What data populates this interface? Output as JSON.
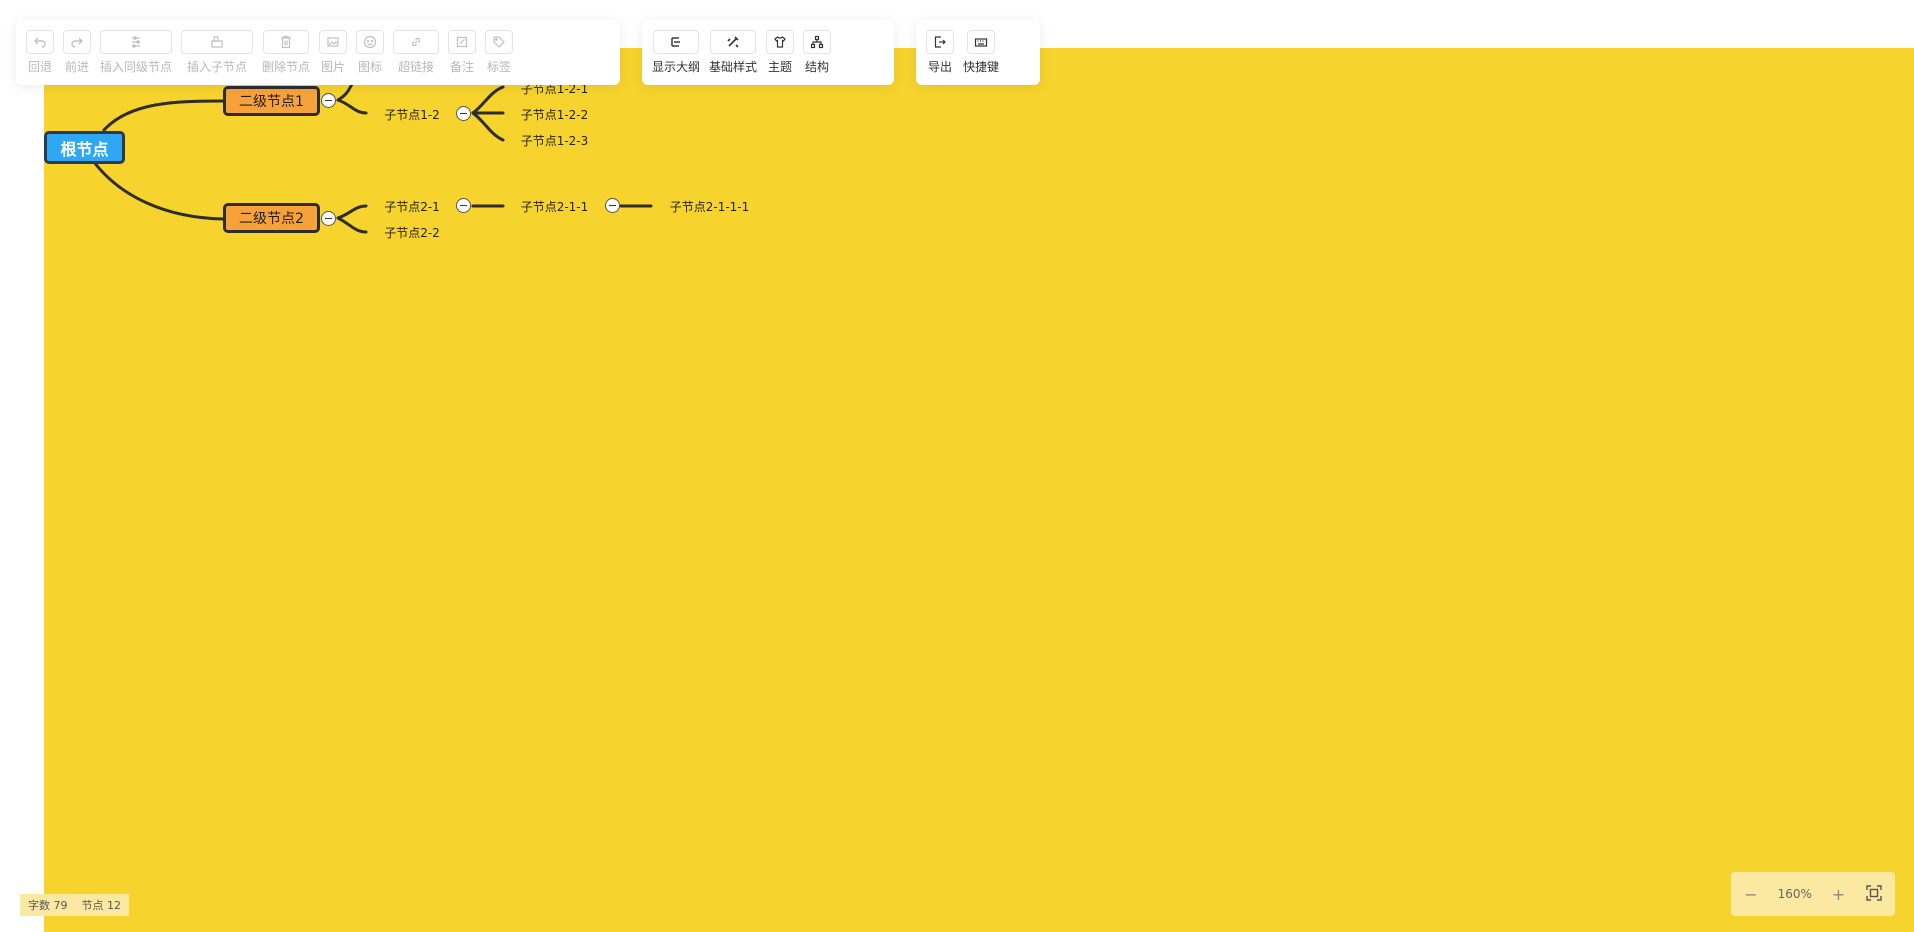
{
  "toolbar": {
    "edit_group": [
      {
        "label": "回退",
        "icon": "undo-icon"
      },
      {
        "label": "前进",
        "icon": "redo-icon"
      },
      {
        "label": "插入同级节点",
        "icon": "insert-sibling-icon"
      },
      {
        "label": "插入子节点",
        "icon": "insert-child-icon"
      },
      {
        "label": "删除节点",
        "icon": "delete-icon"
      },
      {
        "label": "图片",
        "icon": "image-icon"
      },
      {
        "label": "图标",
        "icon": "emoji-icon"
      },
      {
        "label": "超链接",
        "icon": "link-icon"
      },
      {
        "label": "备注",
        "icon": "note-icon"
      },
      {
        "label": "标签",
        "icon": "tag-icon"
      }
    ],
    "view_group": [
      {
        "label": "显示大纲",
        "icon": "outline-icon"
      },
      {
        "label": "基础样式",
        "icon": "style-icon"
      },
      {
        "label": "主题",
        "icon": "theme-icon"
      },
      {
        "label": "结构",
        "icon": "structure-icon"
      }
    ],
    "io_group": [
      {
        "label": "导出",
        "icon": "export-icon"
      },
      {
        "label": "快捷键",
        "icon": "keyboard-icon"
      }
    ]
  },
  "mindmap": {
    "root": "根节点",
    "level2": [
      "二级节点1",
      "二级节点2"
    ],
    "nodes": {
      "n1_2": "子节点1-2",
      "n1_2_1": "子节点1-2-1",
      "n1_2_2": "子节点1-2-2",
      "n1_2_3": "子节点1-2-3",
      "n2_1": "子节点2-1",
      "n2_2": "子节点2-2",
      "n2_1_1": "子节点2-1-1",
      "n2_1_1_1": "子节点2-1-1-1"
    }
  },
  "status": {
    "word_count_label": "字数",
    "word_count": "79",
    "node_count_label": "节点",
    "node_count": "12"
  },
  "zoom": {
    "level": "160%",
    "minus": "−",
    "plus": "+"
  },
  "colors": {
    "canvas_background": "#f6d32d",
    "root_fill": "#2fa7f3",
    "level2_fill": "#f7a13b",
    "line": "#2d2d2d"
  }
}
